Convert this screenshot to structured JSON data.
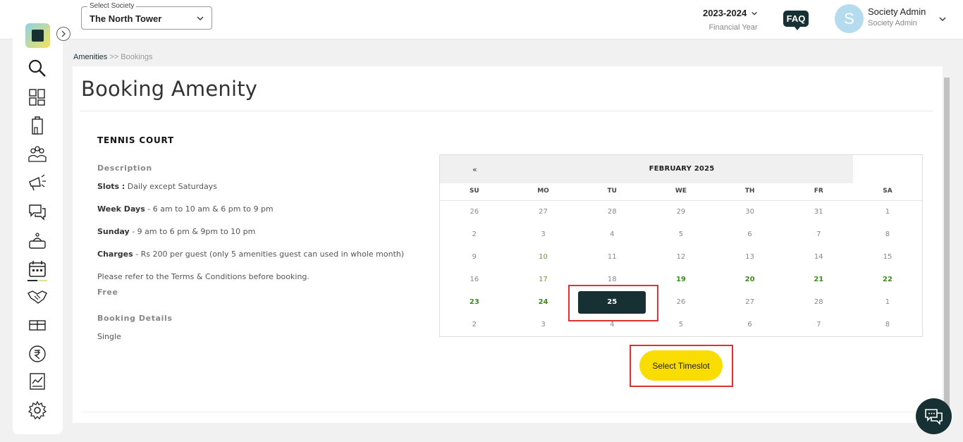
{
  "header": {
    "society_select_label": "Select Society",
    "society_select_value": "The North Tower",
    "financial_year": "2023-2024",
    "financial_year_label": "Financial Year",
    "faq_label": "FAQ",
    "user_initial": "S",
    "user_name": "Society Admin",
    "user_role": "Society Admin"
  },
  "sidebar": {
    "items": [
      {
        "icon": "search-icon"
      },
      {
        "icon": "dashboard-icon"
      },
      {
        "icon": "building-icon"
      },
      {
        "icon": "residents-icon"
      },
      {
        "icon": "announcement-icon"
      },
      {
        "icon": "chat-icon"
      },
      {
        "icon": "service-icon"
      },
      {
        "icon": "calendar-icon",
        "active": true
      },
      {
        "icon": "handshake-icon"
      },
      {
        "icon": "parcel-icon"
      },
      {
        "icon": "rupee-icon"
      },
      {
        "icon": "report-icon"
      },
      {
        "icon": "settings-icon"
      }
    ]
  },
  "breadcrumb": {
    "parent": "Amenities",
    "separator": " >> ",
    "current": "Bookings"
  },
  "page": {
    "title": "Booking Amenity"
  },
  "amenity": {
    "name": "TENNIS COURT",
    "description_title": "Description",
    "slots_label": "Slots :",
    "slots_value": " Daily except Saturdays",
    "weekdays_label": "Week Days",
    "weekdays_value": " - 6 am to 10 am & 6 pm to 9 pm",
    "sunday_label": "Sunday",
    "sunday_value": " - 9 am to 6 pm & 9pm to 10 pm",
    "charges_label": "Charges",
    "charges_value": " - Rs 200 per guest (only 5 amenities guest can used in whole month)",
    "terms_note": "Please refer to the Terms & Conditions before booking.",
    "price_type": "Free",
    "booking_details_title": "Booking Details",
    "booking_type": "Single"
  },
  "calendar": {
    "prev_label": "«",
    "month_label": "FEBRUARY 2025",
    "weekdays": [
      "SU",
      "MO",
      "TU",
      "WE",
      "TH",
      "FR",
      "SA"
    ],
    "weeks": [
      [
        {
          "d": "26",
          "s": "off"
        },
        {
          "d": "27",
          "s": "off"
        },
        {
          "d": "28",
          "s": "off"
        },
        {
          "d": "29",
          "s": "off"
        },
        {
          "d": "30",
          "s": "off"
        },
        {
          "d": "31",
          "s": "off"
        },
        {
          "d": "1",
          "s": "off"
        }
      ],
      [
        {
          "d": "2",
          "s": "off"
        },
        {
          "d": "3",
          "s": "off"
        },
        {
          "d": "4",
          "s": "off"
        },
        {
          "d": "5",
          "s": "off"
        },
        {
          "d": "6",
          "s": "off"
        },
        {
          "d": "7",
          "s": "off"
        },
        {
          "d": "8",
          "s": "off"
        }
      ],
      [
        {
          "d": "9",
          "s": "off"
        },
        {
          "d": "10",
          "s": "avail"
        },
        {
          "d": "11",
          "s": "off"
        },
        {
          "d": "12",
          "s": "off"
        },
        {
          "d": "13",
          "s": "off"
        },
        {
          "d": "14",
          "s": "off"
        },
        {
          "d": "15",
          "s": "off"
        }
      ],
      [
        {
          "d": "16",
          "s": "off"
        },
        {
          "d": "17",
          "s": "avail"
        },
        {
          "d": "18",
          "s": "off"
        },
        {
          "d": "19",
          "s": "strong"
        },
        {
          "d": "20",
          "s": "strong"
        },
        {
          "d": "21",
          "s": "strong"
        },
        {
          "d": "22",
          "s": "strong"
        }
      ],
      [
        {
          "d": "23",
          "s": "strong"
        },
        {
          "d": "24",
          "s": "strong"
        },
        {
          "d": "25",
          "s": "selected"
        },
        {
          "d": "26",
          "s": "off"
        },
        {
          "d": "27",
          "s": "off"
        },
        {
          "d": "28",
          "s": "off"
        },
        {
          "d": "1",
          "s": "off"
        }
      ],
      [
        {
          "d": "2",
          "s": "off"
        },
        {
          "d": "3",
          "s": "off"
        },
        {
          "d": "4",
          "s": "off"
        },
        {
          "d": "5",
          "s": "off"
        },
        {
          "d": "6",
          "s": "off"
        },
        {
          "d": "7",
          "s": "off"
        },
        {
          "d": "8",
          "s": "off"
        }
      ]
    ]
  },
  "actions": {
    "select_timeslot_label": "Select Timeslot"
  },
  "colors": {
    "brand_dark": "#173034",
    "accent_yellow": "#f9dc00",
    "highlight_red": "#e03131",
    "available_green": "#3d8a1f"
  }
}
